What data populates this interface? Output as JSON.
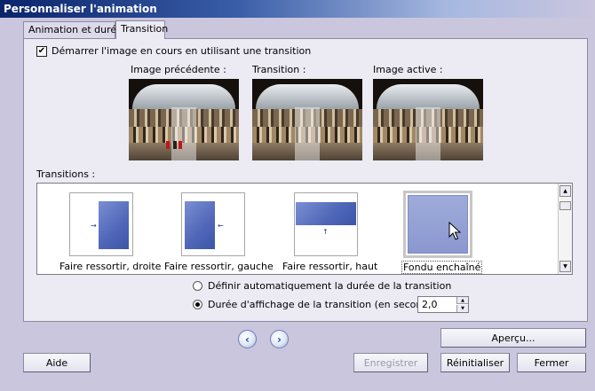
{
  "window": {
    "title": "Personnaliser l'animation"
  },
  "tabs": [
    {
      "label": "Animation et durée"
    },
    {
      "label": "Transition"
    }
  ],
  "start_with_transition": {
    "label": "Démarrer l'image en cours en utilisant une transition",
    "checked": true
  },
  "previews": [
    {
      "label": "Image précédente :"
    },
    {
      "label": "Transition :"
    },
    {
      "label": "Image active :"
    }
  ],
  "transitions": {
    "label": "Transitions :",
    "items": [
      {
        "caption": "Faire ressortir, droite",
        "icon": "fade-out-right-icon"
      },
      {
        "caption": "Faire ressortir, gauche",
        "icon": "fade-out-left-icon"
      },
      {
        "caption": "Faire ressortir, haut",
        "icon": "fade-out-up-icon"
      },
      {
        "caption": "Fondu enchaîné",
        "icon": "crossfade-icon"
      }
    ],
    "selected": "Fondu enchaîné"
  },
  "duration": {
    "auto_label": "Définir automatiquement la durée de la transition",
    "manual_label": "Durée d'affichage de la transition (en secondes)",
    "selected_option": "manual",
    "value": "2,0"
  },
  "buttons": {
    "preview": "Aperçu...",
    "help": "Aide",
    "save": "Enregistrer",
    "reset": "Réinitialiser",
    "close": "Fermer"
  },
  "colors": {
    "title_bar": "#0a246a",
    "dialog_bg": "#c9c6de",
    "transition_blue": "#4f66b8",
    "crossfade_blue": "#8a98d0"
  }
}
